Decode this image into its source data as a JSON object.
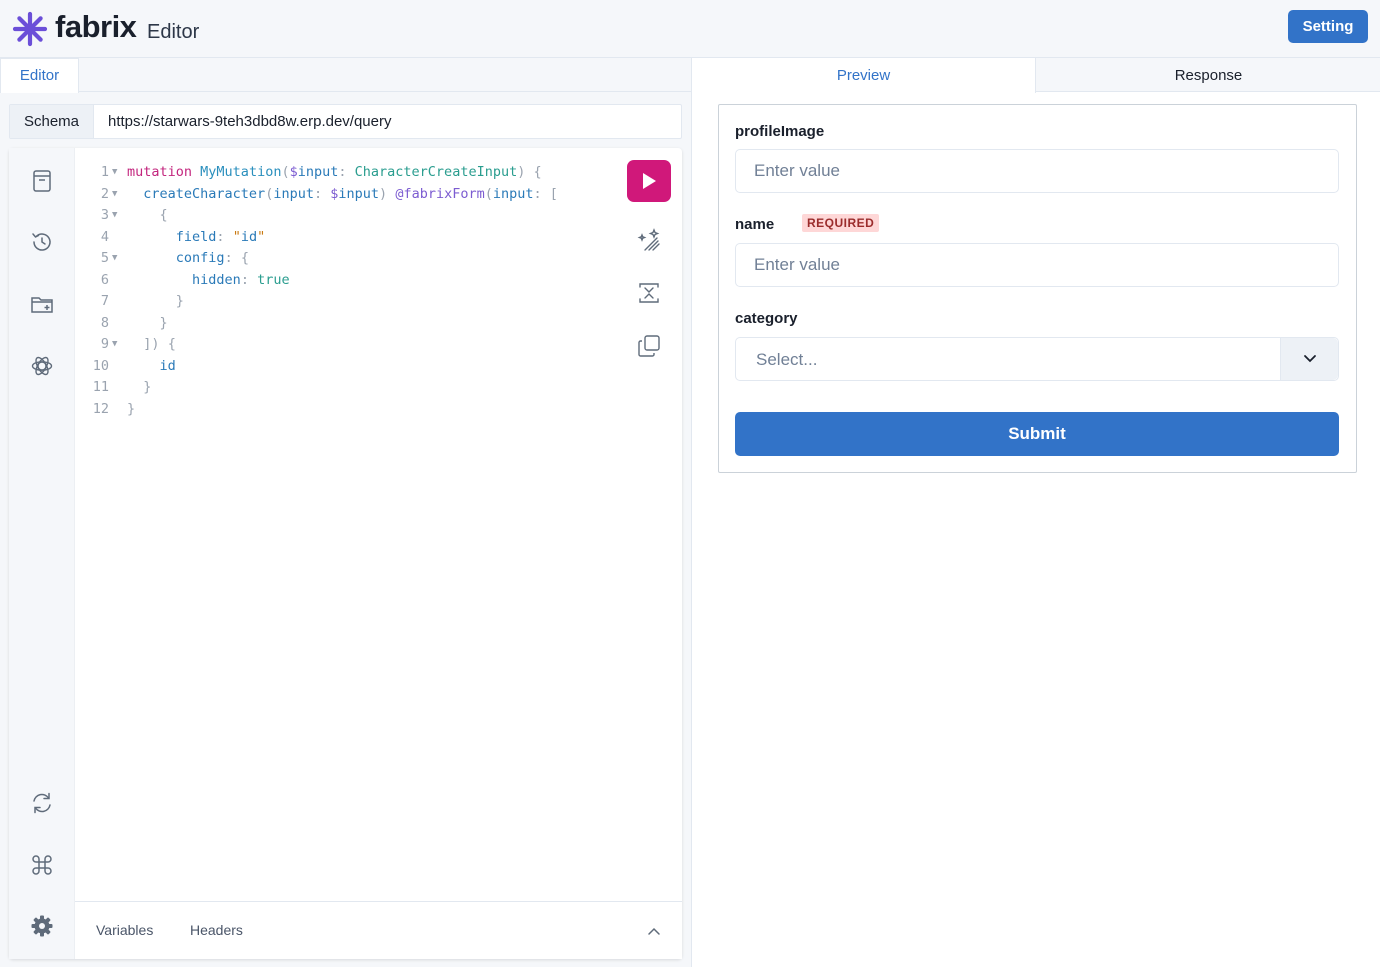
{
  "header": {
    "brand": "fabrix",
    "subtitle": "Editor",
    "setting_label": "Setting"
  },
  "left": {
    "tab_editor": "Editor",
    "schema_label": "Schema",
    "schema_url": "https://starwars-9teh3dbd8w.erp.dev/query",
    "sidebar_icons": [
      "docs-icon",
      "history-icon",
      "explorer-folder-icon",
      "openai-icon",
      "refresh-icon",
      "command-icon",
      "gear-icon"
    ],
    "toolbar_icons": [
      "run-icon",
      "prettify-icon",
      "merge-icon",
      "copy-icon"
    ],
    "bottom_tabs": {
      "variables": "Variables",
      "headers": "Headers"
    },
    "code_lines": [
      "mutation MyMutation($input: CharacterCreateInput) {",
      "  createCharacter(input: $input) @fabrixForm(input: [",
      "    {",
      "      field: \"id\"",
      "      config: {",
      "        hidden: true",
      "      }",
      "    }",
      "  ]) {",
      "    id",
      "  }",
      "}"
    ]
  },
  "right": {
    "tab_preview": "Preview",
    "tab_response": "Response",
    "form": {
      "profile_label": "profileImage",
      "profile_placeholder": "Enter value",
      "name_label": "name",
      "required_badge": "REQUIRED",
      "name_placeholder": "Enter value",
      "category_label": "category",
      "category_placeholder": "Select...",
      "submit_label": "Submit"
    }
  },
  "colors": {
    "accent": "#3273c8",
    "run": "#d0187a",
    "brand_logo": "#6b4fd8"
  }
}
